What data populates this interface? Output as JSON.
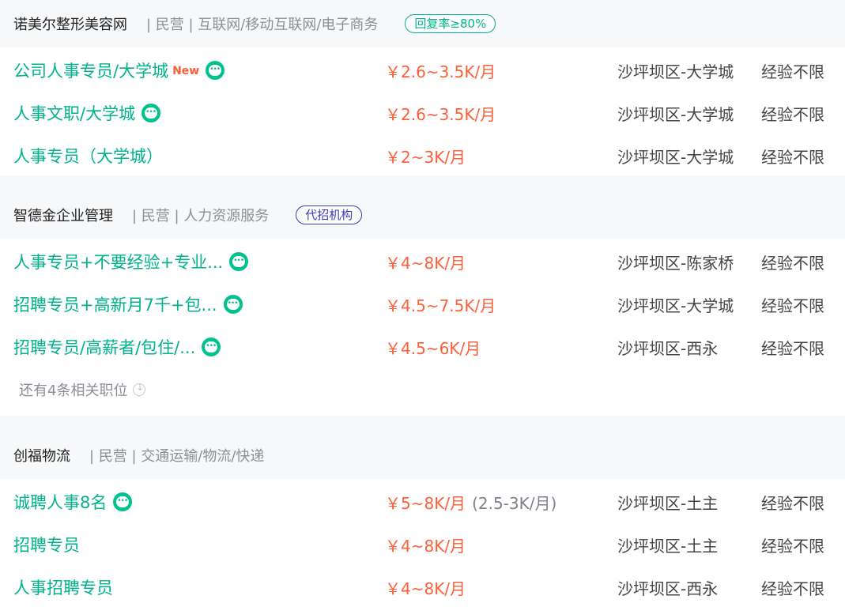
{
  "companies": [
    {
      "name": "诺美尔整形美容网",
      "meta": "| 民营 | 互联网/移动互联网/电子商务",
      "badge": "回复率≥80%",
      "jobs": [
        {
          "title": "公司人事专员/大学城",
          "new": "New",
          "salary": "￥2.6~3.5K/月",
          "location": "沙坪坝区-大学城",
          "experience": "经验不限"
        },
        {
          "title": "人事文职/大学城",
          "salary": "￥2.6~3.5K/月",
          "location": "沙坪坝区-大学城",
          "experience": "经验不限"
        },
        {
          "title": "人事专员（大学城）",
          "salary": "￥2~3K/月",
          "location": "沙坪坝区-大学城",
          "experience": "经验不限"
        }
      ]
    },
    {
      "name": "智德金企业管理",
      "meta": "| 民营 | 人力资源服务",
      "badge": "代招机构",
      "more": "还有4条相关职位",
      "jobs": [
        {
          "title": "人事专员+不要经验+专业...",
          "salary": "￥4~8K/月",
          "location": "沙坪坝区-陈家桥",
          "experience": "经验不限"
        },
        {
          "title": "招聘专员+高新月7千+包...",
          "salary": "￥4.5~7.5K/月",
          "location": "沙坪坝区-大学城",
          "experience": "经验不限"
        },
        {
          "title": "招聘专员/高薪者/包住/...",
          "salary": "￥4.5~6K/月",
          "location": "沙坪坝区-西永",
          "experience": "经验不限"
        }
      ]
    },
    {
      "name": "创福物流",
      "meta": "| 民营 | 交通运输/物流/快递",
      "jobs": [
        {
          "title": "诚聘人事8名",
          "salary": "￥5~8K/月",
          "salary_note": "(2.5-3K/月)",
          "location": "沙坪坝区-土主",
          "experience": "经验不限"
        },
        {
          "title": "招聘专员",
          "salary": "￥4~8K/月",
          "location": "沙坪坝区-土主",
          "experience": "经验不限"
        },
        {
          "title": "人事招聘专员",
          "salary": "￥4~8K/月",
          "location": "沙坪坝区-西永",
          "experience": "经验不限"
        }
      ]
    }
  ]
}
